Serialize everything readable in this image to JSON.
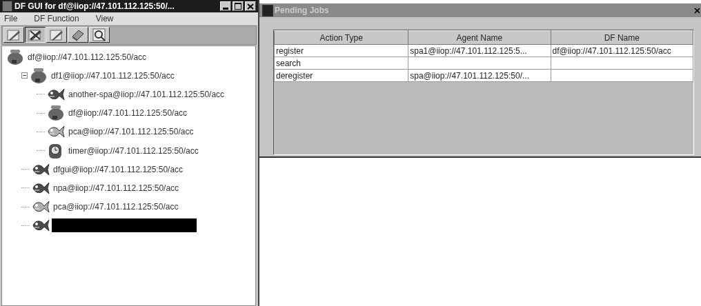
{
  "main_window": {
    "title": "DF GUI for df@iiop://47.101.112.125:50/...",
    "menu": [
      "File",
      "DF Function",
      "View"
    ],
    "toolbar": [
      {
        "kind": "pen"
      },
      {
        "kind": "pen-cross"
      },
      {
        "kind": "pen"
      },
      {
        "kind": "eraser"
      },
      {
        "kind": "search"
      }
    ],
    "tree": [
      {
        "label": "df@iiop://47.101.112.125:50/acc",
        "kind": "df",
        "selected": false,
        "children": [
          {
            "label": "df1@iiop://47.101.112.125:50/acc",
            "kind": "df",
            "selected": false,
            "expanded": true,
            "children": [
              {
                "label": "another-spa@iiop://47.101.112.125:50/acc",
                "kind": "agent",
                "selected": false
              },
              {
                "label": "df@iiop://47.101.112.125:50/acc",
                "kind": "df",
                "selected": false
              },
              {
                "label": "pca@iiop://47.101.112.125:50/acc",
                "kind": "agent-light",
                "selected": false
              },
              {
                "label": "timer@iiop://47.101.112.125:50/acc",
                "kind": "timer",
                "selected": false
              }
            ]
          },
          {
            "label": "dfgui@iiop://47.101.112.125:50/acc",
            "kind": "agent",
            "selected": false
          },
          {
            "label": "npa@iiop://47.101.112.125:50/acc",
            "kind": "agent",
            "selected": false
          },
          {
            "label": "pca@iiop://47.101.112.125:50/acc",
            "kind": "agent-light",
            "selected": false
          },
          {
            "kind": "agent",
            "selected": true
          }
        ]
      }
    ]
  },
  "pending_jobs": {
    "title": "Pending Jobs",
    "table": {
      "columns": [
        "Action Type",
        "Agent Name",
        "DF Name"
      ],
      "rows": [
        [
          "register",
          "spa1@iiop://47.101.112.125:5...",
          "df@iiop://47.101.112.125:50/acc"
        ],
        [
          "search"
        ],
        [
          "deregister",
          "spa@iiop://47.101.112.125:50/..."
        ]
      ]
    }
  }
}
